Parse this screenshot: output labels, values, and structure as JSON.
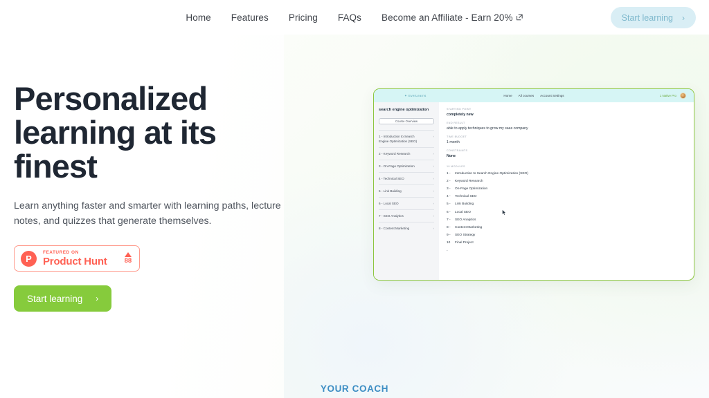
{
  "header": {
    "nav": [
      {
        "label": "Home",
        "external": false
      },
      {
        "label": "Features",
        "external": false
      },
      {
        "label": "Pricing",
        "external": false
      },
      {
        "label": "FAQs",
        "external": false
      },
      {
        "label": "Become an Affiliate - Earn 20%",
        "external": true
      }
    ],
    "cta": {
      "label": "Start learning",
      "chevron": "›",
      "bg": "#d9eef5",
      "color": "#7fb9cd"
    }
  },
  "hero": {
    "headline": "Personalized learning at its finest",
    "subhead": "Learn anything faster and smarter with learning paths, lecture notes, and quizzes that generate themselves.",
    "product_hunt": {
      "logo_letter": "P",
      "featured_label": "FEATURED ON",
      "name": "Product Hunt",
      "vote_count": "88",
      "accent": "#ff6154"
    },
    "cta": {
      "label": "Start learning",
      "chevron": "›",
      "bg": "#86cb3c",
      "color": "#ffffff"
    }
  },
  "mockup": {
    "border_color": "#8cc63f",
    "topbar": {
      "bg": "#d6f5f5",
      "brand": "EverLearns",
      "star": "✦",
      "nav": [
        "Home",
        "All courses",
        "Account Settings"
      ],
      "credits": "1 Native Pro"
    },
    "sidebar": {
      "title": "search engine optimization",
      "overview_button": "Course Overview",
      "items": [
        {
          "label": "1 - Introduction to Search Engine Optimization (SEO)",
          "chevron": "›"
        },
        {
          "label": "2 - Keyword Research",
          "chevron": "›"
        },
        {
          "label": "3 - On-Page Optimization",
          "chevron": "›"
        },
        {
          "label": "4 - Technical SEO",
          "chevron": "›"
        },
        {
          "label": "5 - Link Building",
          "chevron": "›"
        },
        {
          "label": "6 - Local SEO",
          "chevron": "›"
        },
        {
          "label": "7 - SEO Analytics",
          "chevron": "›"
        },
        {
          "label": "8 - Content Marketing",
          "chevron": "›"
        }
      ]
    },
    "main": {
      "fields": [
        {
          "label": "STARTING POINT",
          "value": "completely new"
        },
        {
          "label": "END RESULT",
          "value": "able to apply techniques to grow my saas company"
        },
        {
          "label": "TIME BUDGET",
          "value": "1 month"
        },
        {
          "label": "CONSTRAINTS",
          "value": "None"
        }
      ],
      "modules_label": "10 MODULES",
      "modules": [
        {
          "num": "1 -",
          "label": "Introduction to Search Engine Optimization (SEO)"
        },
        {
          "num": "2 -",
          "label": "Keyword Research"
        },
        {
          "num": "3 -",
          "label": "On-Page Optimization"
        },
        {
          "num": "4 -",
          "label": "Technical SEO"
        },
        {
          "num": "5 -",
          "label": "Link Building"
        },
        {
          "num": "6 -",
          "label": "Local SEO"
        },
        {
          "num": "7 -",
          "label": "SEO Analytics"
        },
        {
          "num": "8 -",
          "label": "Content Marketing"
        },
        {
          "num": "9 -",
          "label": "SEO Strategy"
        },
        {
          "num": "10 -",
          "label": "Final Project"
        }
      ]
    }
  },
  "bottom": {
    "section_label": "YOUR COACH",
    "color": "#3e8ec4"
  }
}
